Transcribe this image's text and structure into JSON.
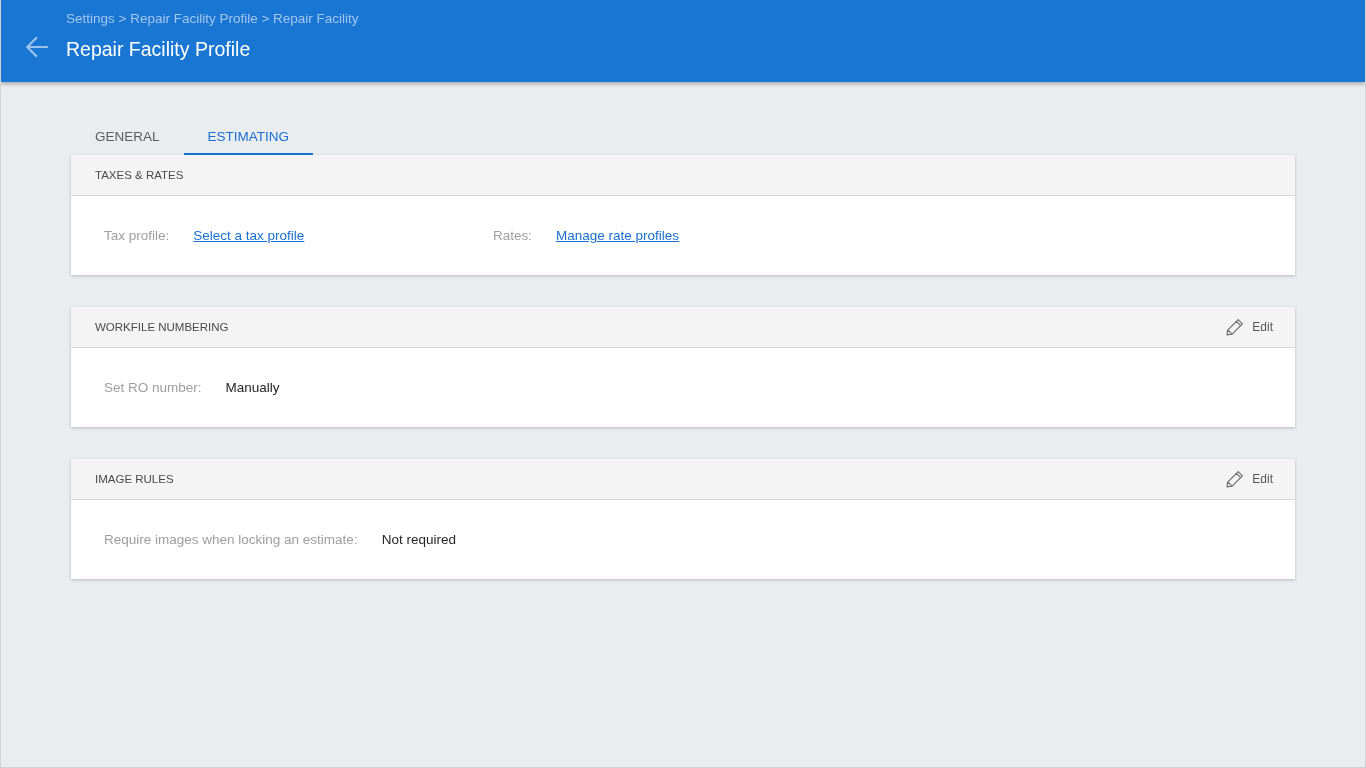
{
  "header": {
    "breadcrumb": "Settings > Repair Facility Profile > Repair Facility",
    "title": "Repair Facility Profile"
  },
  "tabs": [
    {
      "label": "GENERAL",
      "selected": false
    },
    {
      "label": "ESTIMATING",
      "selected": true
    }
  ],
  "sections": [
    {
      "title": "TAXES & RATES",
      "fields": [
        {
          "label": "Tax profile:",
          "value": "Select a tax profile",
          "kind": "link"
        },
        {
          "label": "Rates:",
          "value": "Manage rate profiles",
          "kind": "link"
        }
      ]
    },
    {
      "title": "WORKFILE NUMBERING",
      "edit_button": {
        "label": "Edit"
      },
      "fields": [
        {
          "label": "Set RO number:",
          "value": "Manually",
          "kind": "text"
        }
      ]
    },
    {
      "title": "IMAGE RULES",
      "edit_button": {
        "label": "Edit"
      },
      "fields": [
        {
          "label": "Require images when locking an estimate:",
          "value": "Not required",
          "kind": "text"
        }
      ]
    }
  ]
}
